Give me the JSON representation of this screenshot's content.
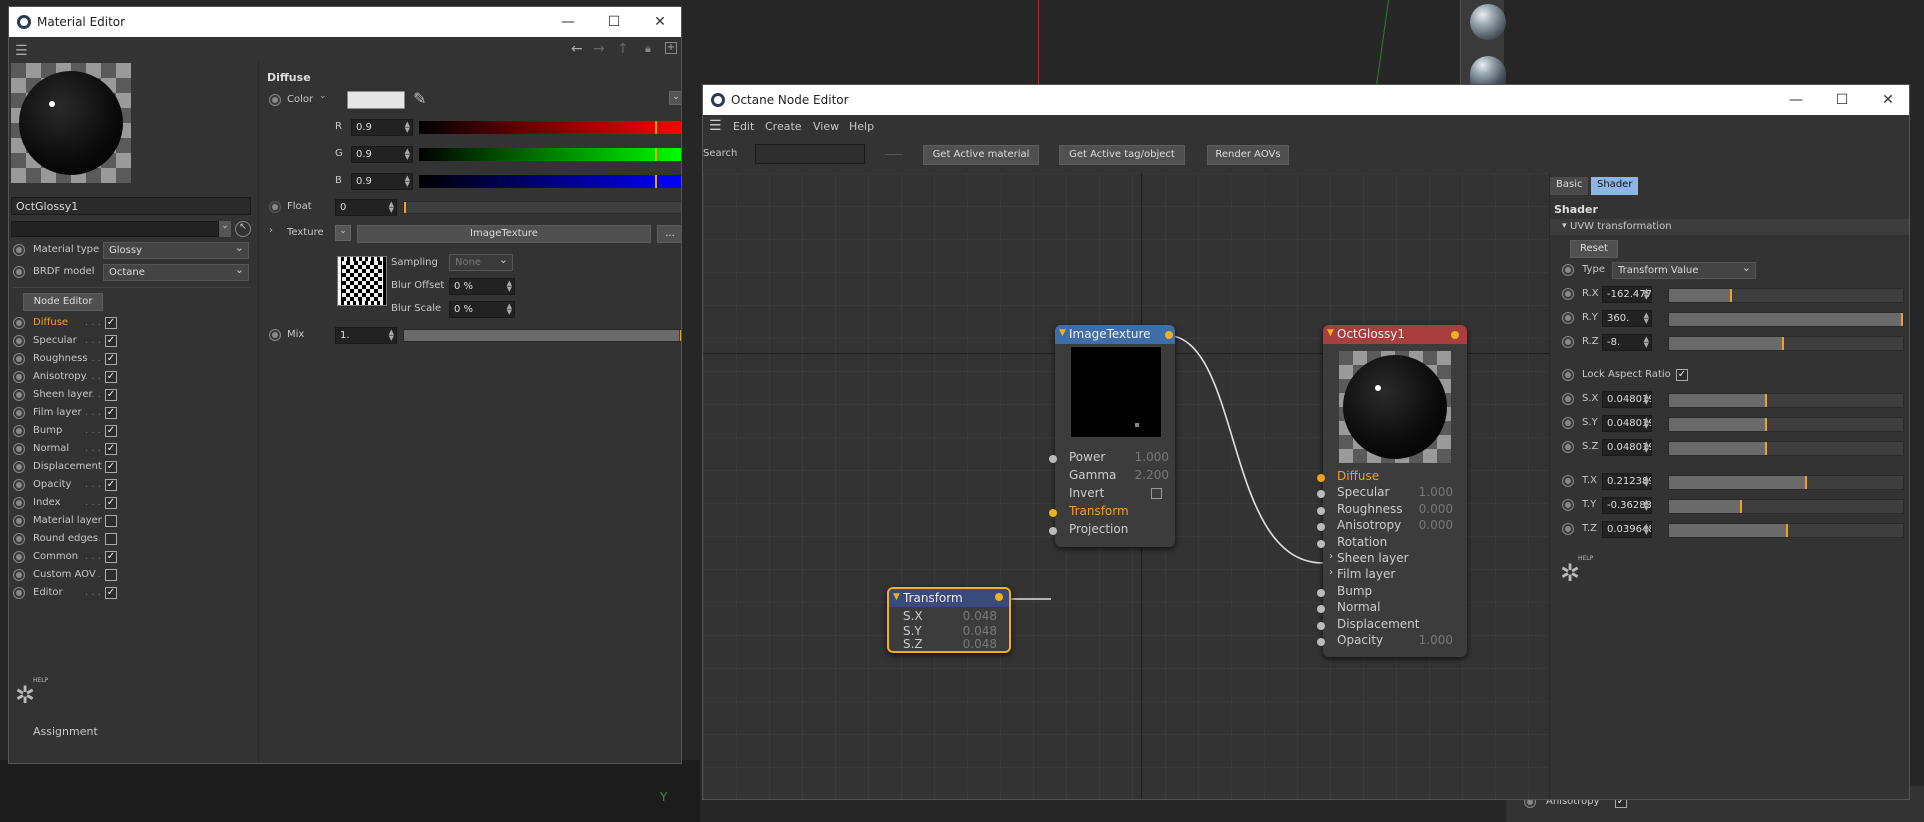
{
  "material_editor": {
    "title": "Material Editor",
    "material_name": "OctGlossy1",
    "material_type_label": "Material type",
    "material_type_value": "Glossy",
    "brdf_label": "BRDF model",
    "brdf_value": "Octane",
    "node_editor_button": "Node Editor",
    "channels": [
      {
        "label": "Diffuse",
        "checked": true
      },
      {
        "label": "Specular",
        "checked": true
      },
      {
        "label": "Roughness",
        "checked": true
      },
      {
        "label": "Anisotropy",
        "checked": true
      },
      {
        "label": "Sheen layer",
        "checked": true
      },
      {
        "label": "Film layer",
        "checked": true
      },
      {
        "label": "Bump",
        "checked": true
      },
      {
        "label": "Normal",
        "checked": true
      },
      {
        "label": "Displacement",
        "checked": true
      },
      {
        "label": "Opacity",
        "checked": true
      },
      {
        "label": "Index",
        "checked": true
      },
      {
        "label": "Material layer",
        "checked": false
      },
      {
        "label": "Round edges",
        "checked": false
      },
      {
        "label": "Common",
        "checked": true
      },
      {
        "label": "Custom AOV",
        "checked": false
      },
      {
        "label": "Editor",
        "checked": true
      }
    ],
    "help_label": "HELP",
    "assignment_label": "Assignment",
    "diffuse": {
      "section_title": "Diffuse",
      "color_label": "Color",
      "r_label": "R",
      "r_value": "0.9",
      "g_label": "G",
      "g_value": "0.9",
      "b_label": "B",
      "b_value": "0.9",
      "rgb_level": 0.9,
      "float_label": "Float",
      "float_value": "0",
      "texture_label": "Texture",
      "texture_value": "ImageTexture",
      "texture_more": "...",
      "sampling_label": "Sampling",
      "sampling_value": "None",
      "blur_offset_label": "Blur Offset",
      "blur_offset_value": "0 %",
      "blur_scale_label": "Blur Scale",
      "blur_scale_value": "0 %",
      "mix_label": "Mix",
      "mix_value": "1."
    }
  },
  "node_editor": {
    "title": "Octane Node Editor",
    "menu": [
      "Edit",
      "Create",
      "View",
      "Help"
    ],
    "search_label": "Search",
    "search_value": "",
    "buttons": [
      "Get Active material",
      "Get Active tag/object",
      "Render AOVs"
    ],
    "nodes": {
      "image_texture": {
        "title": "ImageTexture",
        "power_label": "Power",
        "power_value": "1.000",
        "gamma_label": "Gamma",
        "gamma_value": "2.200",
        "invert_label": "Invert",
        "transform_label": "Transform",
        "projection_label": "Projection"
      },
      "transform": {
        "title": "Transform",
        "sx_label": "S.X",
        "sx_value": "0.048",
        "sy_label": "S.Y",
        "sy_value": "0.048",
        "sz_label": "S.Z",
        "sz_value": "0.048"
      },
      "oct_glossy": {
        "title": "OctGlossy1",
        "pins": [
          {
            "label": "Diffuse",
            "value": ""
          },
          {
            "label": "Specular",
            "value": "1.000"
          },
          {
            "label": "Roughness",
            "value": "0.000"
          },
          {
            "label": "Anisotropy",
            "value": "0.000"
          },
          {
            "label": "Rotation",
            "value": ""
          },
          {
            "label": "Sheen layer",
            "value": ""
          },
          {
            "label": "Film layer",
            "value": ""
          },
          {
            "label": "Bump",
            "value": ""
          },
          {
            "label": "Normal",
            "value": ""
          },
          {
            "label": "Displacement",
            "value": ""
          },
          {
            "label": "Opacity",
            "value": "1.000"
          }
        ]
      }
    },
    "attributes": {
      "tabs": [
        "Basic",
        "Shader"
      ],
      "active_tab": "Shader",
      "section_title": "Shader",
      "group_title": "UVW transformation",
      "reset_button": "Reset",
      "type_label": "Type",
      "type_value": "Transform Value",
      "rows": [
        {
          "label": "R.X",
          "value": "-162.4778",
          "level": 0.27
        },
        {
          "label": "R.Y",
          "value": "360.",
          "level": 1.0
        },
        {
          "label": "R.Z",
          "value": "-8.",
          "level": 0.49
        }
      ],
      "lock_aspect_label": "Lock Aspect Ratio",
      "lock_aspect_checked": true,
      "scale_rows": [
        {
          "label": "S.X",
          "value": "0.048019",
          "level": 0.42
        },
        {
          "label": "S.Y",
          "value": "0.048019",
          "level": 0.42
        },
        {
          "label": "S.Z",
          "value": "0.048019",
          "level": 0.42
        }
      ],
      "translate_rows": [
        {
          "label": "T.X",
          "value": "0.212389",
          "level": 0.59
        },
        {
          "label": "T.Y",
          "value": "-0.362832",
          "level": 0.31
        },
        {
          "label": "T.Z",
          "value": "0.039648",
          "level": 0.51
        }
      ],
      "help_label": "HELP"
    }
  },
  "background": {
    "panel_anisotropy_label": "Anisotropy",
    "axis_label": "Y"
  },
  "colors": {
    "accent_orange": "#f0a020",
    "node_blue_header": "#3e6ea8",
    "node_red_header": "#a83e3e",
    "active_tab": "#8fb4e8"
  }
}
